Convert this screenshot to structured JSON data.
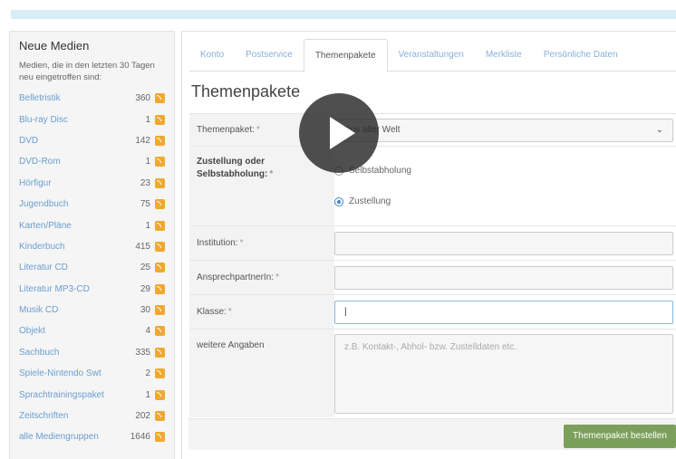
{
  "sidebar": {
    "title": "Neue Medien",
    "description": "Medien, die in den letzten 30 Tagen neu eingetroffen sind:",
    "items": [
      {
        "label": "Belletristik",
        "count": "360"
      },
      {
        "label": "Blu-ray Disc",
        "count": "1"
      },
      {
        "label": "DVD",
        "count": "142"
      },
      {
        "label": "DVD-Rom",
        "count": "1"
      },
      {
        "label": "Hörfigur",
        "count": "23"
      },
      {
        "label": "Jugendbuch",
        "count": "75"
      },
      {
        "label": "Karten/Pläne",
        "count": "1"
      },
      {
        "label": "Kinderbuch",
        "count": "415"
      },
      {
        "label": "Literatur CD",
        "count": "25"
      },
      {
        "label": "Literatur MP3-CD",
        "count": "29"
      },
      {
        "label": "Musik CD",
        "count": "30"
      },
      {
        "label": "Objekt",
        "count": "4"
      },
      {
        "label": "Sachbuch",
        "count": "335"
      },
      {
        "label": "Spiele-Nintendo Swt",
        "count": "2"
      },
      {
        "label": "Sprachtrainingspaket",
        "count": "1"
      },
      {
        "label": "Zeitschriften",
        "count": "202"
      },
      {
        "label": "alle Mediengruppen",
        "count": "1646"
      }
    ]
  },
  "tabs": [
    "Konto",
    "Postservice",
    "Themenpakete",
    "Veranstaltungen",
    "Merkliste",
    "Persönliche Daten"
  ],
  "active_tab": "Themenpakete",
  "page_title": "Themenpakete",
  "form": {
    "themenpaket_label": "Themenpaket:",
    "themenpaket_value": "Aus aller Welt",
    "zustellung_label": "Zustellung oder Selbstabholung:",
    "option_selbst": "Selbstabholung",
    "option_zustellung": "Zustellung",
    "institution_label": "Institution:",
    "ansprech_label": "AnsprechpartnerIn:",
    "klasse_label": "Klasse:",
    "weitere_label": "weitere Angaben",
    "weitere_placeholder": "z.B. Kontakt-, Abhol- bzw. Zustelldaten etc.",
    "required_mark": "*",
    "submit_label": "Themenpaket bestellen"
  },
  "colors": {
    "submit": "#7ba05b",
    "link": "#6a9ed0",
    "rss": "#f0a830"
  }
}
